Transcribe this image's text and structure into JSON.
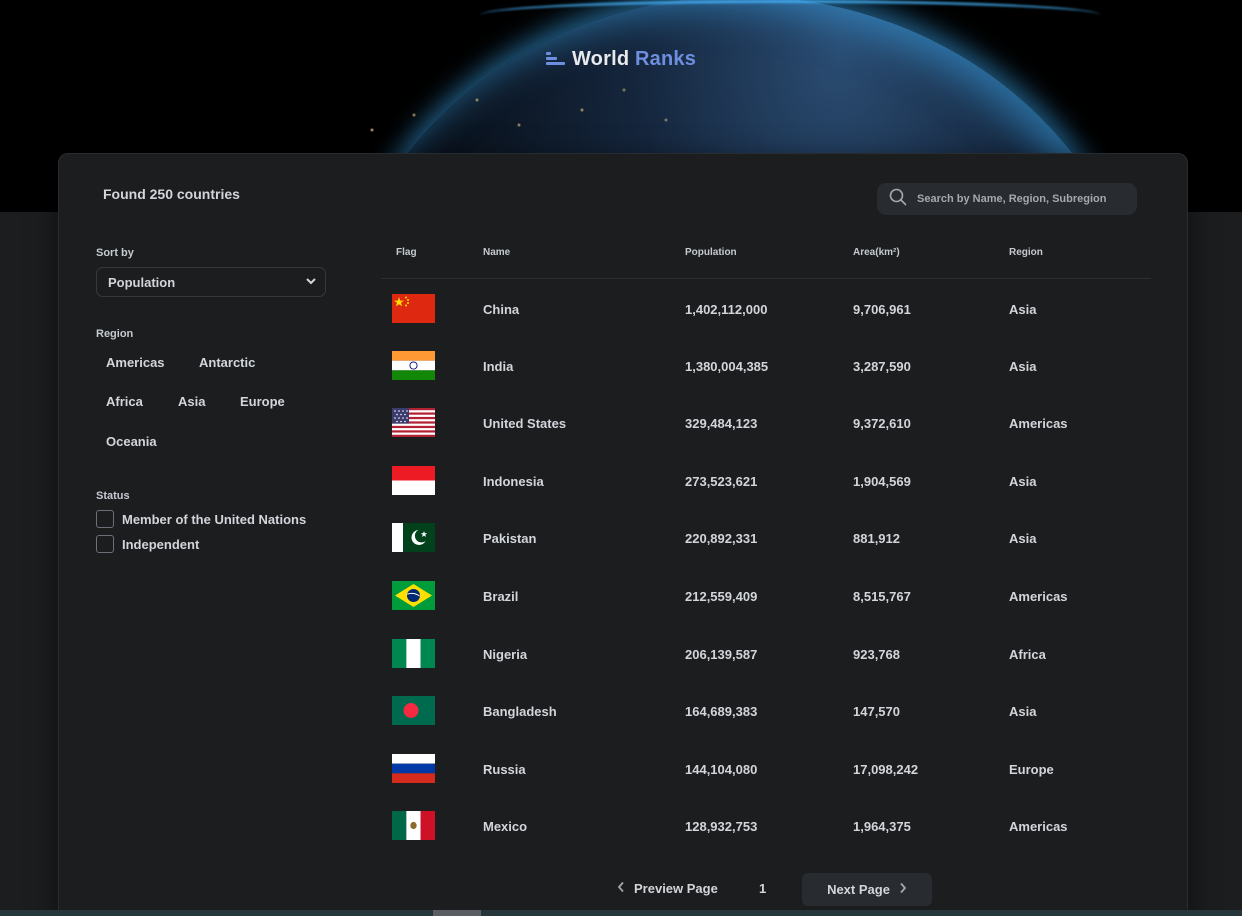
{
  "app": {
    "logo_prefix": "World",
    "logo_accent": "Ranks"
  },
  "summary": {
    "found_text": "Found 250 countries"
  },
  "search": {
    "placeholder": "Search by Name, Region, Subregion"
  },
  "sort": {
    "label": "Sort by",
    "selected": "Population"
  },
  "region_filter": {
    "label": "Region",
    "options": [
      "Americas",
      "Antarctic",
      "Africa",
      "Asia",
      "Europe",
      "Oceania"
    ]
  },
  "status_filter": {
    "label": "Status",
    "options": [
      "Member of the United Nations",
      "Independent"
    ]
  },
  "table": {
    "headers": {
      "flag": "Flag",
      "name": "Name",
      "population": "Population",
      "area": "Area(km²)",
      "region": "Region"
    },
    "rows": [
      {
        "name": "China",
        "population": "1,402,112,000",
        "area": "9,706,961",
        "region": "Asia",
        "flag": "china"
      },
      {
        "name": "India",
        "population": "1,380,004,385",
        "area": "3,287,590",
        "region": "Asia",
        "flag": "india"
      },
      {
        "name": "United States",
        "population": "329,484,123",
        "area": "9,372,610",
        "region": "Americas",
        "flag": "united-states"
      },
      {
        "name": "Indonesia",
        "population": "273,523,621",
        "area": "1,904,569",
        "region": "Asia",
        "flag": "indonesia"
      },
      {
        "name": "Pakistan",
        "population": "220,892,331",
        "area": "881,912",
        "region": "Asia",
        "flag": "pakistan"
      },
      {
        "name": "Brazil",
        "population": "212,559,409",
        "area": "8,515,767",
        "region": "Americas",
        "flag": "brazil"
      },
      {
        "name": "Nigeria",
        "population": "206,139,587",
        "area": "923,768",
        "region": "Africa",
        "flag": "nigeria"
      },
      {
        "name": "Bangladesh",
        "population": "164,689,383",
        "area": "147,570",
        "region": "Asia",
        "flag": "bangladesh"
      },
      {
        "name": "Russia",
        "population": "144,104,080",
        "area": "17,098,242",
        "region": "Europe",
        "flag": "russia"
      },
      {
        "name": "Mexico",
        "population": "128,932,753",
        "area": "1,964,375",
        "region": "Americas",
        "flag": "mexico"
      }
    ]
  },
  "pagination": {
    "prev_label": "Preview Page",
    "current_page": "1",
    "next_label": "Next Page"
  },
  "colors": {
    "background": "#1b1d1f",
    "accent": "#6e8fe0",
    "panel": "#282b30",
    "text": "#d2d5da"
  }
}
